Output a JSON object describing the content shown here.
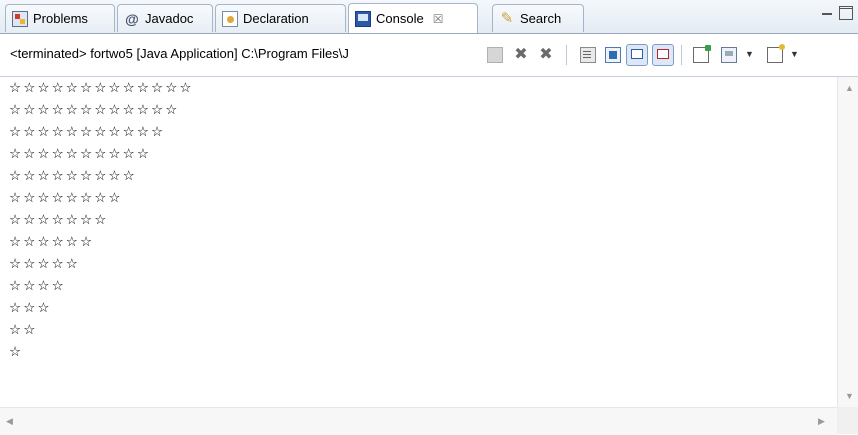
{
  "tabs": [
    {
      "label": "Problems",
      "icon": "problems-icon"
    },
    {
      "label": "Javadoc",
      "icon": "javadoc-icon"
    },
    {
      "label": "Declaration",
      "icon": "declaration-icon"
    },
    {
      "label": "Console",
      "icon": "console-icon",
      "active": true,
      "close": "☒"
    },
    {
      "label": "Search",
      "icon": "search-icon"
    }
  ],
  "toolbar": {
    "status_text": "<terminated> fortwo5 [Java Application] C:\\Program Files\\J"
  },
  "console": {
    "output": "☆☆☆☆☆☆☆☆☆☆☆☆☆\n☆☆☆☆☆☆☆☆☆☆☆☆\n☆☆☆☆☆☆☆☆☆☆☆\n☆☆☆☆☆☆☆☆☆☆\n☆☆☆☆☆☆☆☆☆\n☆☆☆☆☆☆☆☆\n☆☆☆☆☆☆☆\n☆☆☆☆☆☆\n☆☆☆☆☆\n☆☆☆☆\n☆☆☆\n☆☆\n☆"
  }
}
